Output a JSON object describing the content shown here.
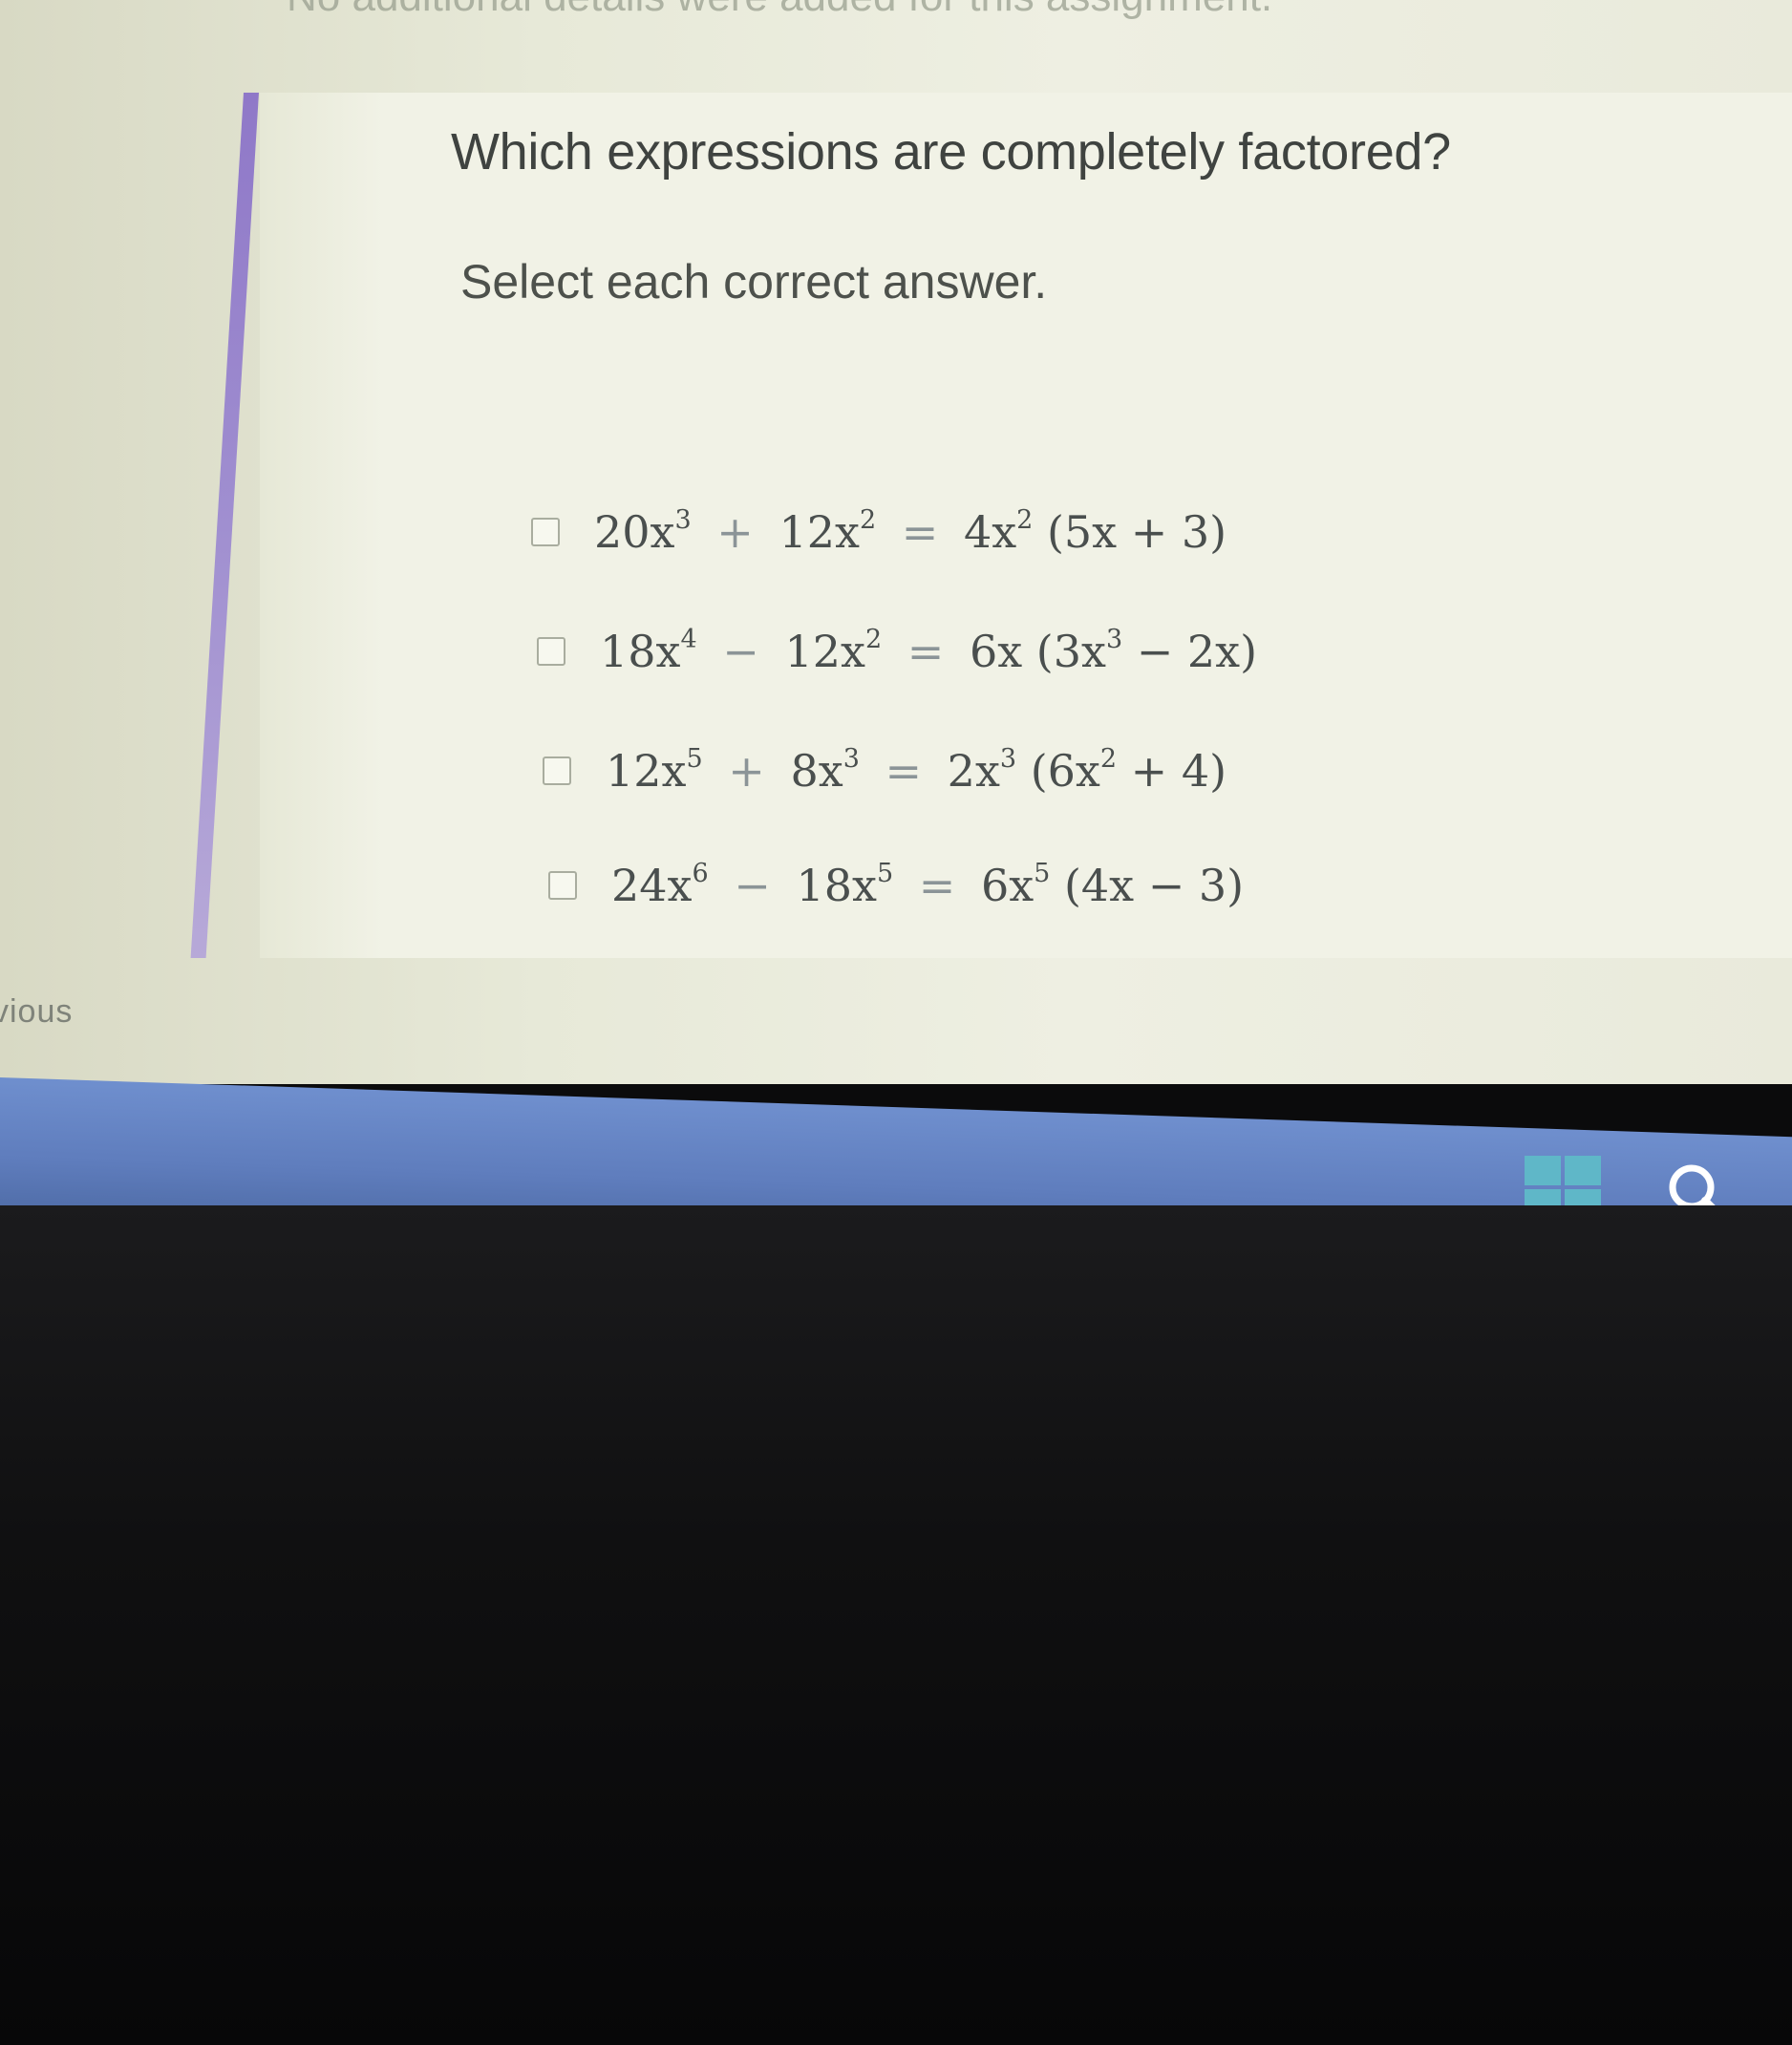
{
  "top_note": "No additional details were added for this assignment.",
  "question": "Which expressions are completely factored?",
  "instructions": "Select each correct answer.",
  "options": [
    {
      "t1": "20x",
      "e1": "3",
      "op1": "+",
      "t2": "12x",
      "e2": "2",
      "eq": "=",
      "t3": "4x",
      "e3": "2",
      "t4": " (5x + 3)"
    },
    {
      "t1": "18x",
      "e1": "4",
      "op1": "−",
      "t2": "12x",
      "e2": "2",
      "eq": "=",
      "t3": "6x (3x",
      "e3": "3",
      "t4": " − 2x)"
    },
    {
      "t1": "12x",
      "e1": "5",
      "op1": "+",
      "t2": "8x",
      "e2": "3",
      "eq": "=",
      "t3": "2x",
      "e3": "3",
      "t4": " (6x",
      "e4": "2",
      "t5": " + 4)"
    },
    {
      "t1": "24x",
      "e1": "6",
      "op1": "−",
      "t2": "18x",
      "e2": "5",
      "eq": "=",
      "t3": "6x",
      "e3": "5",
      "t4": " (4x − 3)"
    }
  ],
  "nav": {
    "previous_label": "vious"
  },
  "icons": {
    "start": "windows-start-icon",
    "search": "search-icon"
  },
  "colors": {
    "accent": "#9a86cf",
    "taskbar": "#6384c4",
    "windows_icon": "#5fb7c8"
  }
}
